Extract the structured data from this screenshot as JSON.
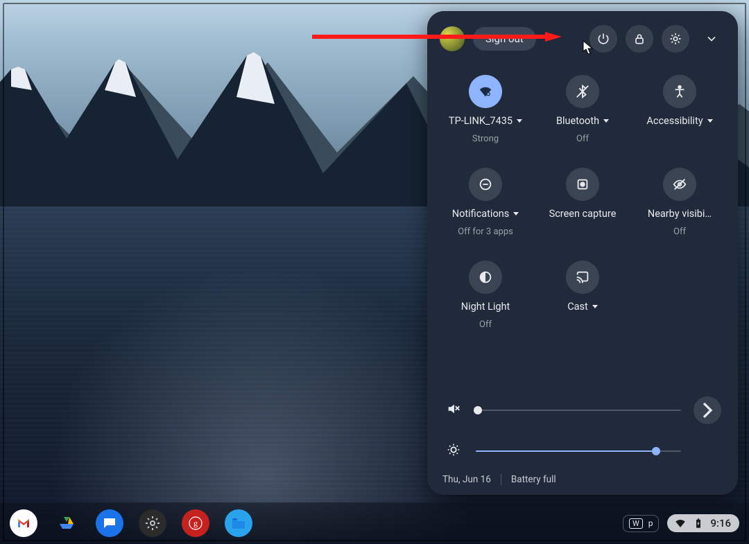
{
  "panel": {
    "sign_out": "Sign out",
    "tiles": {
      "wifi": {
        "label": "TP-LINK_7435",
        "sub": "Strong",
        "has_menu": true,
        "active": true
      },
      "bluetooth": {
        "label": "Bluetooth",
        "sub": "Off",
        "has_menu": true,
        "active": false
      },
      "accessibility": {
        "label": "Accessibility",
        "sub": "",
        "has_menu": true,
        "active": false
      },
      "notifications": {
        "label": "Notifications",
        "sub": "Off for 3 apps",
        "has_menu": true,
        "active": false
      },
      "capture": {
        "label": "Screen capture",
        "sub": "",
        "has_menu": false,
        "active": false
      },
      "nearby": {
        "label": "Nearby visibi…",
        "sub": "Off",
        "has_menu": false,
        "active": false
      },
      "nightlight": {
        "label": "Night Light",
        "sub": "Off",
        "has_menu": false,
        "active": false
      },
      "cast": {
        "label": "Cast",
        "sub": "",
        "has_menu": true,
        "active": false
      }
    },
    "sliders": {
      "volume": {
        "value": 0
      },
      "brightness": {
        "value": 88
      }
    },
    "footer": {
      "date": "Thu, Jun 16",
      "battery": "Battery full"
    }
  },
  "shelf": {
    "ime_key": "W",
    "ime_layout": "p",
    "clock": "9:16"
  }
}
